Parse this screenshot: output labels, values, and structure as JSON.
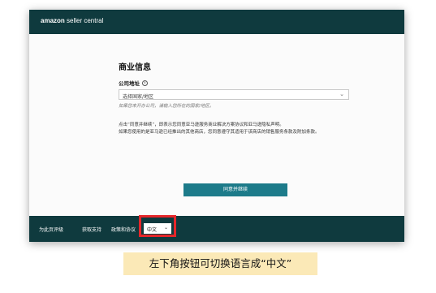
{
  "header": {
    "brand_bold": "amazon",
    "brand_light": " seller central"
  },
  "form": {
    "title": "商业信息",
    "field_label": "公司地址",
    "select_value": "选择国家/地区",
    "hint": "如果您未开办公司，请输入您所在的国家/地区。",
    "terms_line1": "点击“同意并继续”，即表示您同意亚马逊服务商业解决方案协议和亚马逊隐私声明。",
    "terms_line2": "如果您使用的是亚马逊已经推出的其他商店，您同意遵守其适用于该商店的销售服务条款及附加条款。"
  },
  "buttons": {
    "agree": "同意并继续"
  },
  "footer": {
    "link1": "为此页评级",
    "link2": "获取支持",
    "link3": "政策和协议",
    "language": "中文"
  },
  "annotation": {
    "callout": "左下角按钮可切换语言成“中文”"
  },
  "colors": {
    "header_bg": "#0f3a3e",
    "button_bg": "#1d7b8a",
    "highlight": "#e5262a",
    "callout_bg": "#fbe9b7"
  }
}
